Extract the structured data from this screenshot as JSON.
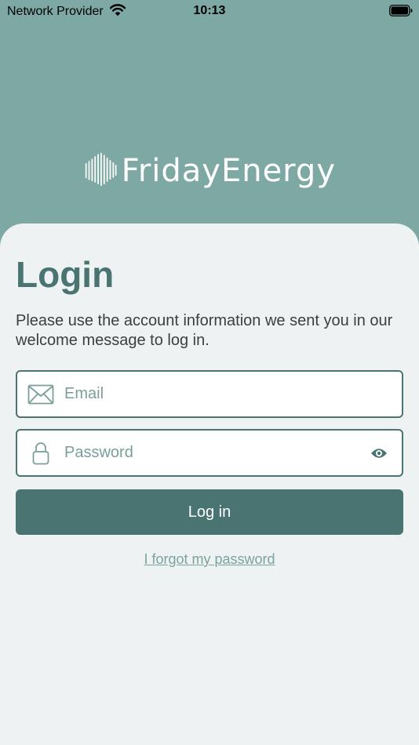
{
  "status_bar": {
    "carrier": "Network Provider",
    "time": "10:13"
  },
  "logo": {
    "text": "FridayEnergy"
  },
  "login": {
    "title": "Login",
    "intro": "Please use the account information we sent you in our welcome message to log in.",
    "email_placeholder": "Email",
    "password_placeholder": "Password",
    "button_label": "Log in",
    "forgot_label": "I forgot my password"
  },
  "icons": {
    "wifi": "wifi-icon",
    "battery": "battery-icon",
    "logo_mark": "soundwave-logo-icon",
    "email": "envelope-icon",
    "password": "lock-icon",
    "toggle": "eye-icon"
  },
  "colors": {
    "header_background": "#7da8a3",
    "sheet_background": "#eef2f2",
    "accent": "#4a7471",
    "link": "#7aa39f"
  }
}
